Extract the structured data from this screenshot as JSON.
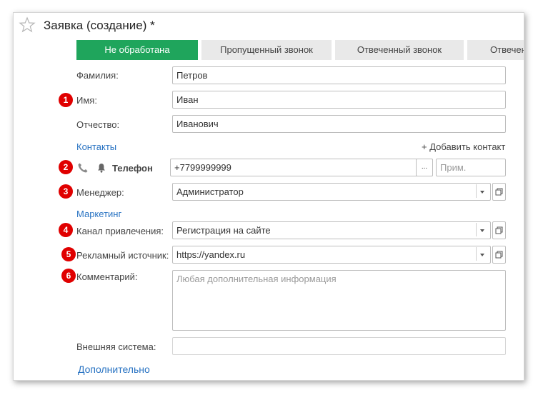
{
  "window": {
    "title": "Заявка (создание) *"
  },
  "tabs": [
    {
      "label": "Не обработана",
      "active": true
    },
    {
      "label": "Пропущенный звонок",
      "active": false
    },
    {
      "label": "Отвеченный звонок",
      "active": false
    },
    {
      "label": "Отвечен",
      "active": false
    }
  ],
  "fields": {
    "surname": {
      "label": "Фамилия:",
      "value": "Петров"
    },
    "name": {
      "label": "Имя:",
      "value": "Иван"
    },
    "patronymic": {
      "label": "Отчество:",
      "value": "Иванович"
    }
  },
  "contacts": {
    "section_label": "Контакты",
    "add_label": "+ Добавить контакт",
    "phone": {
      "type_label": "Телефон",
      "value": "+7799999999",
      "select_button": "...",
      "note_placeholder": "Прим."
    }
  },
  "manager": {
    "label": "Менеджер:",
    "value": "Администратор"
  },
  "marketing": {
    "section_label": "Маркетинг",
    "channel": {
      "label": "Канал привлечения:",
      "value": "Регистрация на сайте"
    },
    "source": {
      "label": "Рекламный источник:",
      "value": "https://yandex.ru"
    }
  },
  "comment": {
    "label": "Комментарий:",
    "placeholder": "Любая дополнительная информация"
  },
  "external_system": {
    "label": "Внешняя система:",
    "value": ""
  },
  "more_link": "Дополнительно",
  "markers": [
    "1",
    "2",
    "3",
    "4",
    "5",
    "6"
  ],
  "icons": {
    "favorite": "star-icon",
    "phone": "phone-icon",
    "notification": "bell-icon",
    "dropdown": "chevron-down-icon",
    "open": "open-window-icon"
  },
  "colors": {
    "active_tab": "#1fa55c",
    "link": "#2a74c3",
    "marker": "#e00000"
  }
}
